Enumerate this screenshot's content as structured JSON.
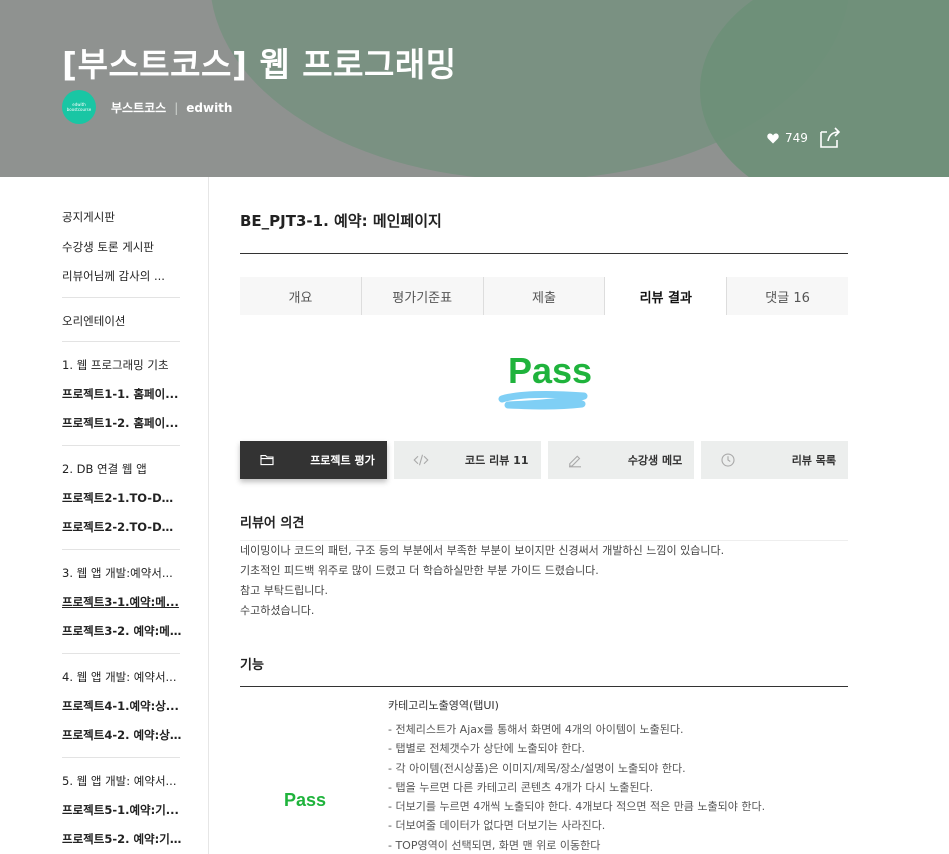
{
  "header": {
    "course_title": "[부스트코스] 웹 프로그래밍",
    "logo_text": "edwith boostcourse",
    "org_name": "부스트코스",
    "separator": "|",
    "platform": "edwith",
    "likes": "749",
    "like_icon": "heart-icon",
    "share_icon": "share-icon"
  },
  "sidebar": {
    "items": [
      {
        "label": "공지게시판",
        "bold": false
      },
      {
        "label": "수강생 토론 게시판",
        "bold": false
      },
      {
        "label": "리뷰어님께 감사의 ...",
        "bold": false
      },
      {
        "label": "오리엔테이션",
        "bold": false
      },
      {
        "label": "1. 웹 프로그래밍 기초",
        "bold": false
      },
      {
        "label": "프로젝트1-1. 홈페이...",
        "bold": true
      },
      {
        "label": "프로젝트1-2. 홈페이...",
        "bold": true
      },
      {
        "label": "2. DB 연결 웹 앱",
        "bold": false
      },
      {
        "label": "프로젝트2-1.TO-DO_...",
        "bold": true
      },
      {
        "label": "프로젝트2-2.TO-DO_...",
        "bold": true
      },
      {
        "label": "3. 웹 앱 개발:예약서...",
        "bold": false
      },
      {
        "label": "프로젝트3-1.예약:메...",
        "bold": true
      },
      {
        "label": "프로젝트3-2. 예약:메...",
        "bold": true
      },
      {
        "label": "4. 웹 앱 개발: 예약서...",
        "bold": false
      },
      {
        "label": "프로젝트4-1.예약:상...",
        "bold": true
      },
      {
        "label": "프로젝트4-2. 예약:상...",
        "bold": true
      },
      {
        "label": "5. 웹 앱 개발: 예약서...",
        "bold": false
      },
      {
        "label": "프로젝트5-1.예약:기...",
        "bold": true
      },
      {
        "label": "프로젝트5-2. 예약:기...",
        "bold": true
      }
    ]
  },
  "main": {
    "page_title": "BE_PJT3-1. 예약: 메인페이지",
    "tabs": [
      {
        "label": "개요"
      },
      {
        "label": "평가기준표"
      },
      {
        "label": "제출"
      },
      {
        "label": "리뷰 결과"
      },
      {
        "label": "댓글 16"
      }
    ],
    "active_tab": "리뷰 결과",
    "result": "Pass",
    "actions": [
      {
        "label": "프로젝트 평가",
        "icon": "folder-icon"
      },
      {
        "label": "코드 리뷰 11",
        "icon": "code-icon"
      },
      {
        "label": "수강생 메모",
        "icon": "pencil-icon"
      },
      {
        "label": "리뷰 목록",
        "icon": "clock-icon"
      }
    ],
    "reviewer_opinion_title": "리뷰어 의견",
    "reviewer_opinion": [
      "네이밍이나 코드의 패턴, 구조 등의 부분에서 부족한 부분이 보이지만 신경써서 개발하신 느낌이 있습니다.",
      "기초적인 피드백 위주로 많이 드렸고 더 학습하실만한 부분 가이드 드렸습니다.",
      "참고 부탁드립니다.",
      "수고하셨습니다."
    ],
    "function_title": "기능",
    "function_result": "Pass",
    "function_heading": "카테고리노출영역(탭UI)",
    "criteria": [
      "- 전체리스트가 Ajax를 통해서 화면에 4개의 아이템이 노출된다.",
      "- 탭별로 전체갯수가 상단에 노출되야 한다.",
      "- 각 아이템(전시상품)은 이미지/제목/장소/설명이 노출되야 한다.",
      "- 탭을 누르면 다른 카테고리 콘텐츠 4개가 다시 노출된다.",
      "- 더보기를 누르면 4개씩 노출되야 한다. 4개보다 적으면 적은 만큼 노출되야 한다.",
      "- 더보여줄 데이터가 없다면 더보기는 사라진다.",
      "- TOP영역이 선택되면, 화면 맨 위로 이동한다"
    ]
  },
  "colors": {
    "header_bg": "#8f9290",
    "header_accent": "#7a9182",
    "logo_bg": "#19c6a4",
    "pass_green": "#1fb33c",
    "highlight_blue": "#7fcff5",
    "active_action_bg": "#333333"
  }
}
